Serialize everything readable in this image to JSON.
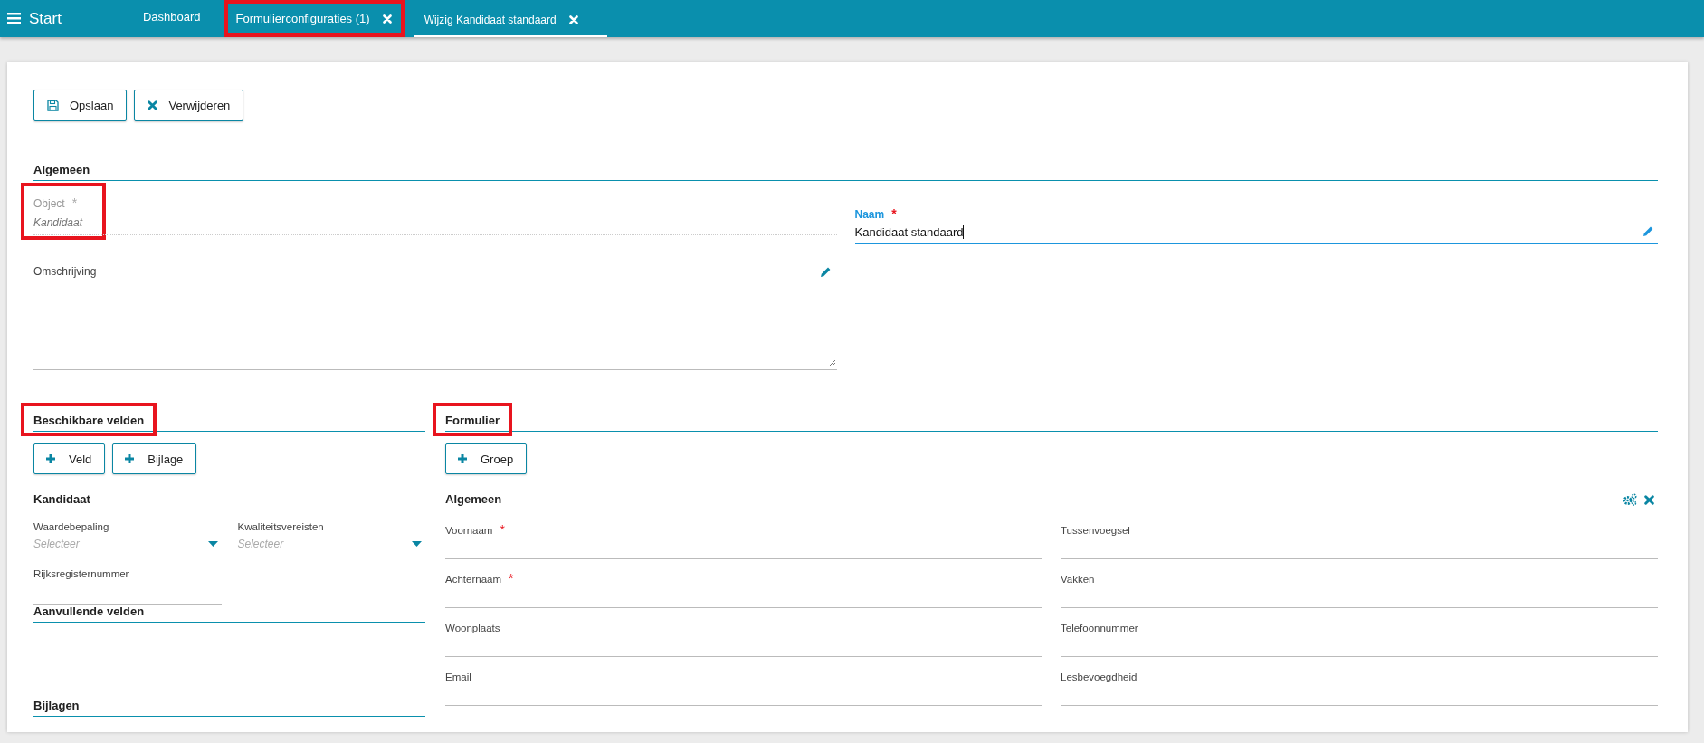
{
  "top_bar": {
    "menu_label": "Start",
    "tabs": [
      {
        "label": "Dashboard",
        "selected": false,
        "closable": false,
        "highlighted": false
      },
      {
        "label": "Formulierconfiguraties (1)",
        "selected": false,
        "closable": true,
        "highlighted": true
      },
      {
        "label": "Wijzig Kandidaat standaard",
        "selected": true,
        "closable": true,
        "highlighted": false
      }
    ]
  },
  "toolbar": [
    {
      "label": "Opslaan",
      "kind": "save"
    },
    {
      "label": "Verwijderen",
      "kind": "delete"
    }
  ],
  "general": {
    "title": "Algemeen",
    "object": {
      "label": "Object",
      "required_mark": "*",
      "value": "Kandidaat",
      "highlighted": true
    },
    "name": {
      "label": "Naam",
      "required_mark": "*",
      "value": "Kandidaat standaard",
      "focused": true
    },
    "description": {
      "label": "Omschrijving"
    }
  },
  "available": {
    "title": "Beschikbare velden",
    "highlighted": true,
    "buttons": [
      "Veld",
      "Bijlage"
    ],
    "groups": [
      {
        "title": "Kandidaat",
        "fields": [
          {
            "kind": "select",
            "label": "Waardebepaling",
            "placeholder": "Selecteer"
          },
          {
            "kind": "select",
            "label": "Kwaliteitsvereisten",
            "placeholder": "Selecteer"
          },
          {
            "kind": "text",
            "label": "Rijksregisternummer"
          }
        ]
      },
      {
        "title": "Aanvullende velden"
      },
      {
        "title": "Bijlagen"
      }
    ]
  },
  "form": {
    "title": "Formulier",
    "highlighted": true,
    "buttons": [
      "Groep"
    ],
    "groups": [
      {
        "title": "Algemeen",
        "fields": [
          {
            "label": "Voornaam",
            "required_mark": "*"
          },
          {
            "label": "Tussenvoegsel"
          },
          {
            "label": "Achternaam",
            "required_mark": "*"
          },
          {
            "label": "Vakken"
          },
          {
            "label": "Woonplaats"
          },
          {
            "label": "Telefoonnummer"
          },
          {
            "label": "Email"
          },
          {
            "label": "Lesbevoegdheid"
          }
        ]
      }
    ]
  }
}
